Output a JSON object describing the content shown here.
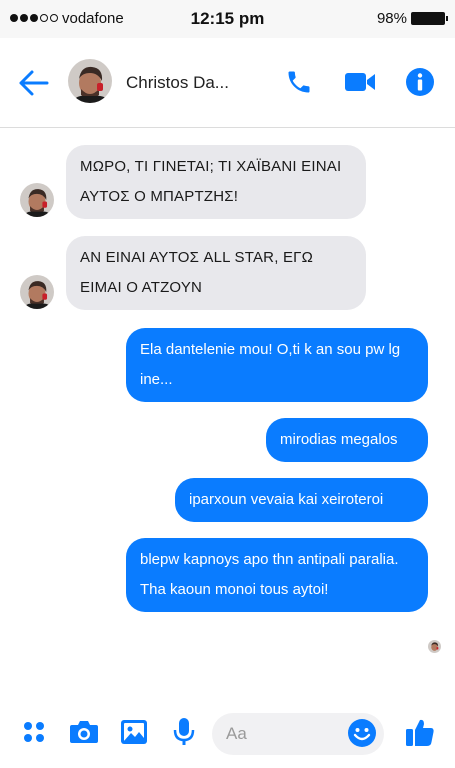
{
  "status_bar": {
    "carrier": "vodafone",
    "time": "12:15 pm",
    "battery": "98%",
    "signal_bars_filled": 3,
    "signal_bars_total": 5
  },
  "header": {
    "contact_name": "Christos Da...",
    "icons": [
      "back-arrow-icon",
      "phone-icon",
      "video-camera-icon",
      "info-icon"
    ]
  },
  "messages": {
    "incoming": [
      {
        "text": "ΜΩΡΟ, ΤΙ ΓΙΝΕΤΑΙ; ΤΙ ΧΑΪΒΑΝΙ ΕΙΝΑΙ ΑΥΤΟΣ Ο ΜΠΑΡΤΖΗΣ!"
      },
      {
        "text": "ΑΝ ΕΙΝΑΙ ΑΥΤΟΣ ALL STAR, ΕΓΩ ΕΙΜΑΙ Ο ΑΤΖΟΥΝ"
      }
    ],
    "outgoing": [
      {
        "text": "Ela dantelenie mou! O,ti k an sou pw lg ine..."
      },
      {
        "text": "mirodias megalos"
      },
      {
        "text": "iparxoun vevaia kai xeiroteroi"
      },
      {
        "text": "blepw kapnoys apo thn antipali paralia. Tha kaoun monoi tous aytoi!"
      }
    ]
  },
  "composer": {
    "placeholder": "Aa",
    "icons": [
      "apps-icon",
      "camera-icon",
      "image-icon",
      "microphone-icon",
      "emoji-icon",
      "thumbs-up-icon"
    ]
  },
  "colors": {
    "accent": "#0a7cff",
    "incoming_bubble": "#e8e8ec",
    "status_bar_bg": "#f7f7f7"
  }
}
